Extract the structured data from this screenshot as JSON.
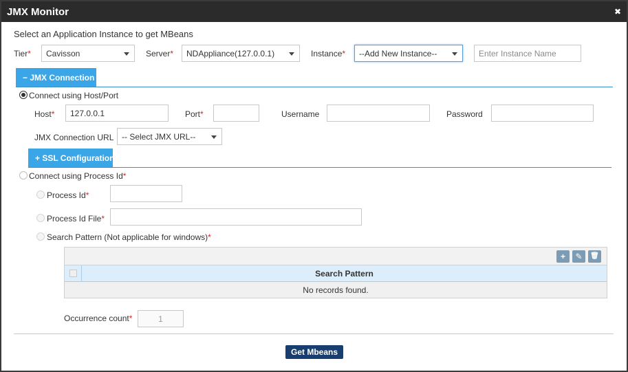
{
  "window": {
    "title": "JMX Monitor",
    "close_glyph": "✖"
  },
  "form": {
    "heading": "Select an Application Instance to get MBeans",
    "tier": {
      "label": "Tier",
      "value": "Cavisson"
    },
    "server": {
      "label": "Server",
      "value": "NDAppliance(127.0.0.1)"
    },
    "instance": {
      "label": "Instance",
      "value": "--Add New Instance--",
      "name_placeholder": "Enter Instance Name"
    },
    "required_mark": "*"
  },
  "jmx_connection": {
    "tab_label": "− JMX Connection",
    "radio_label": "Connect using Host/Port",
    "host": {
      "label": "Host",
      "value": "127.0.0.1"
    },
    "port": {
      "label": "Port",
      "value": ""
    },
    "username": {
      "label": "Username",
      "value": ""
    },
    "password": {
      "label": "Password",
      "value": ""
    },
    "url": {
      "label": "JMX Connection URL",
      "value": "-- Select JMX URL--"
    }
  },
  "ssl": {
    "tab_label": "+ SSL Configuration"
  },
  "process": {
    "radio_label": "Connect using Process Id",
    "process_id_label": "Process Id",
    "process_id_file_label": "Process Id File",
    "search_pattern_label": "Search Pattern (Not applicable for windows)"
  },
  "grid": {
    "toolbar": {
      "add_glyph": "+",
      "edit_glyph": "✎",
      "delete_glyph": "🗑"
    },
    "column": "Search Pattern",
    "empty_message": "No records found."
  },
  "occurrence": {
    "label": "Occurrence count",
    "value": "1"
  },
  "actions": {
    "get_mbeans": "Get Mbeans"
  },
  "colors": {
    "accent": "#3aa6e8",
    "primary": "#173e6e",
    "titlebar": "#2b2b2b",
    "required": "#e02020",
    "jmx_line": "#3a8fc9",
    "ssl_line": "#2aa87a"
  }
}
